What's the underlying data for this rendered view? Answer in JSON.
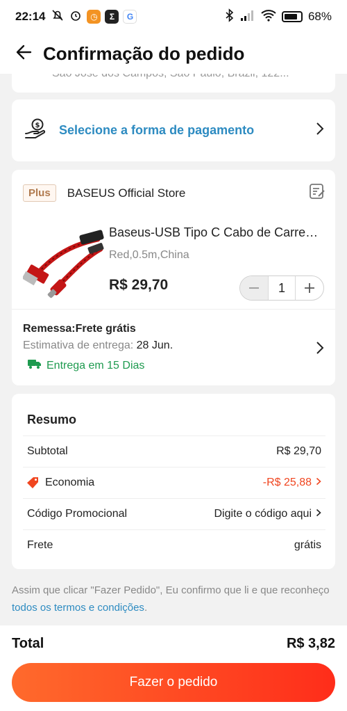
{
  "status_bar": {
    "time": "22:14",
    "battery": "68%",
    "battery_level": 0.68
  },
  "header": {
    "title": "Confirmação do pedido"
  },
  "address": {
    "partial_line": "São José dos Campos, São Paulo, Brazil, 122..."
  },
  "payment": {
    "label": "Selecione a forma de pagamento"
  },
  "store": {
    "badge": "Plus",
    "name": "BASEUS Official Store",
    "product": {
      "title": "Baseus-USB Tipo C Cabo de Carregamento",
      "variant": "Red,0.5m,China",
      "price": "R$ 29,70",
      "quantity": "1"
    },
    "shipping": {
      "title": "Remessa:Frete grátis",
      "estimate_label": "Estimativa de entrega:",
      "estimate_date": "28 Jun.",
      "fast": "Entrega em 15 Dias"
    }
  },
  "summary": {
    "title": "Resumo",
    "subtotal_label": "Subtotal",
    "subtotal_value": "R$ 29,70",
    "savings_label": "Economia",
    "savings_value": "-R$ 25,88",
    "promo_label": "Código Promocional",
    "promo_value": "Digite o código aqui",
    "shipping_label": "Frete",
    "shipping_value": "grátis"
  },
  "terms": {
    "text": "Assim que clicar \"Fazer Pedido\", Eu confirmo que li e que reconheço ",
    "link": "todos os termos e condições",
    "end": "."
  },
  "footer": {
    "total_label": "Total",
    "total_value": "R$ 3,82",
    "button_label": "Fazer o pedido"
  },
  "colors": {
    "accent": "#ff4a22",
    "link": "#2d8bc1",
    "green": "#1e9a4f",
    "discount": "#f0451f"
  }
}
